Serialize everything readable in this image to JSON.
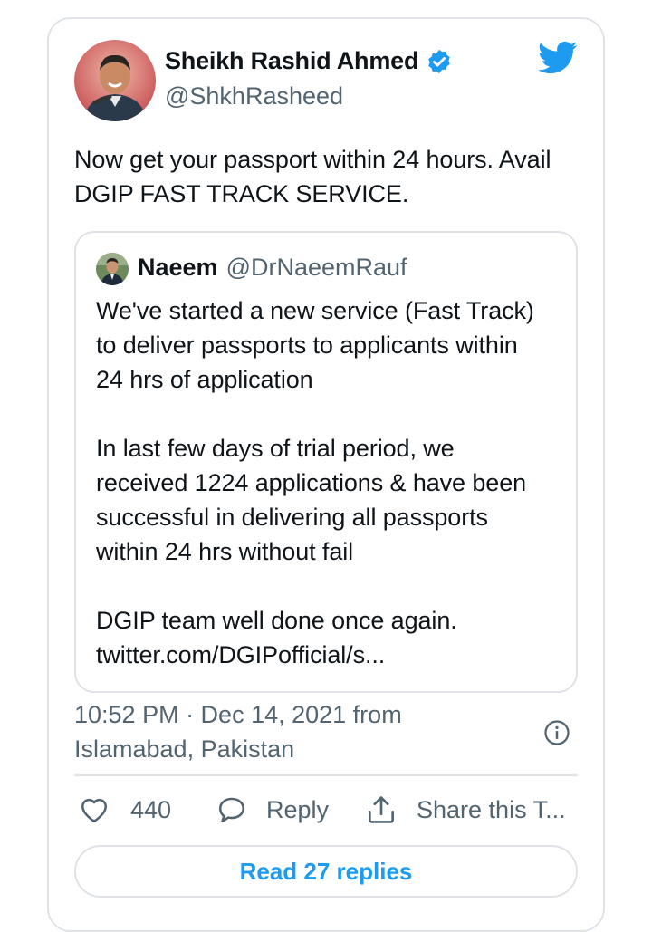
{
  "tweet": {
    "author": {
      "name": "Sheikh Rashid Ahmed",
      "handle": "@ShkhRasheed",
      "avatar_icon": "avatar-photo",
      "verified_icon": "verified-badge-icon"
    },
    "text": "Now get your passport within 24 hours. Avail\nDGIP FAST TRACK SERVICE.",
    "quote": {
      "name": "Naeem",
      "handle": "@DrNaeemRauf",
      "text": "We've started a new service (Fast Track)\nto deliver passports to applicants within\n24 hrs of application\n\nIn last few days of trial period, we\nreceived 1224 applications & have been\nsuccessful in delivering all passports\nwithin 24 hrs without fail\n\nDGIP team well done once again.\ntwitter.com/DGIPofficial/s..."
    },
    "meta": "10:52 PM · Dec 14, 2021 from\nIslamabad, Pakistan",
    "actions": {
      "like_count": "440",
      "reply_label": "Reply",
      "share_label": "Share this T..."
    },
    "read_replies_label": "Read 27 replies"
  },
  "colors": {
    "brand_blue": "#1d9bf0",
    "text_primary": "#0f1419",
    "text_secondary": "#536471",
    "border": "#dfe3e8"
  }
}
